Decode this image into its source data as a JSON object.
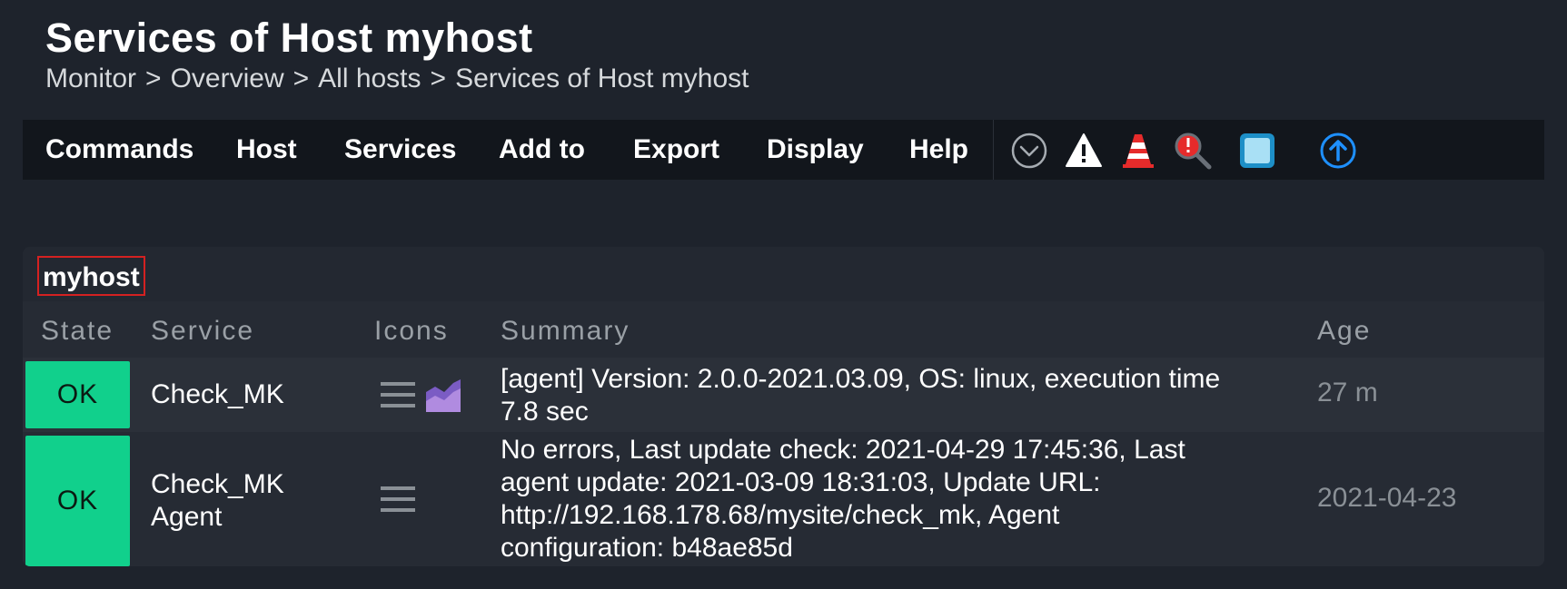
{
  "header": {
    "title": "Services of Host myhost",
    "breadcrumb": [
      "Monitor",
      "Overview",
      "All hosts",
      "Services of Host myhost"
    ],
    "separator": ">"
  },
  "menubar": {
    "items": [
      "Commands",
      "Host",
      "Services",
      "Add to",
      "Export",
      "Display",
      "Help"
    ],
    "icons": [
      "chevron-down-circle-icon",
      "warning-icon",
      "traffic-cone-icon",
      "search-alert-icon",
      "square-toggle-icon",
      "arrow-up-circle-icon"
    ]
  },
  "host_panel": {
    "host": "myhost",
    "columns": [
      "State",
      "Service",
      "Icons",
      "Summary",
      "Age"
    ],
    "rows": [
      {
        "state": "OK",
        "service": "Check_MK",
        "icons": [
          "menu-icon",
          "graph-icon"
        ],
        "summary": "[agent] Version: 2.0.0-2021.03.09, OS: linux, execution time 7.8 sec",
        "age": "27 m"
      },
      {
        "state": "OK",
        "service": "Check_MK Agent",
        "icons": [
          "menu-icon"
        ],
        "summary": "No errors, Last update check: 2021-04-29 17:45:36, Last agent update: 2021-03-09 18:31:03, Update URL: http://192.168.178.68/mysite/check_mk, Agent configuration: b48ae85d",
        "age": "2021-04-23"
      }
    ]
  },
  "colors": {
    "background": "#1e232c",
    "menubar": "#12161c",
    "ok_state": "#11d08c",
    "highlight_border": "#d42121",
    "accent_blue": "#1e90ff"
  }
}
